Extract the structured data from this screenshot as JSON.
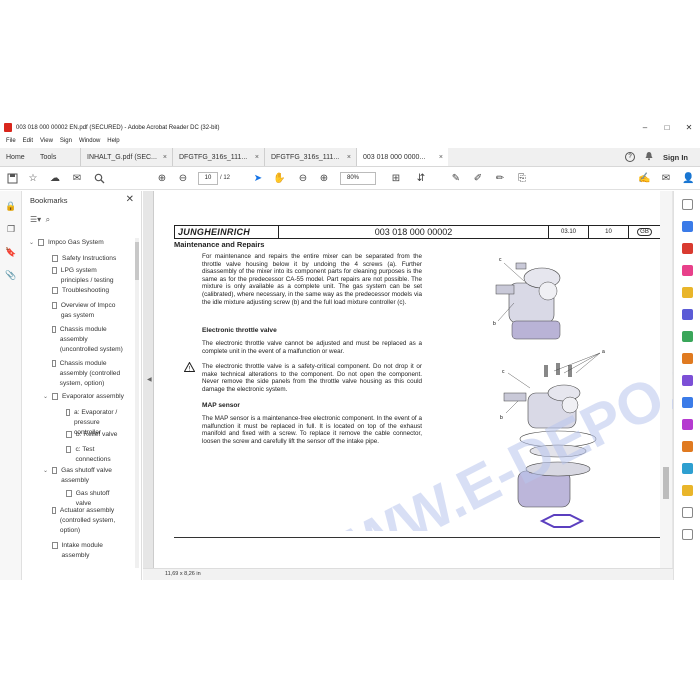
{
  "window": {
    "title": "003 018 000 00002 EN.pdf (SECURED) - Adobe Acrobat Reader DC (32-bit)",
    "minimize": "–",
    "maximize": "□",
    "close": "✕"
  },
  "menu": [
    "File",
    "Edit",
    "View",
    "Sign",
    "Window",
    "Help"
  ],
  "tabs": {
    "home": "Home",
    "tools": "Tools",
    "docs": [
      {
        "label": "INHALT_G.pdf (SEC...",
        "active": false
      },
      {
        "label": "DFGTFG_316s_111...",
        "active": false
      },
      {
        "label": "DFGTFG_316s_111...",
        "active": false
      },
      {
        "label": "003 018 000 0000...",
        "active": true
      }
    ],
    "close_glyph": "×",
    "help_glyph": "?",
    "sign_in": "Sign In"
  },
  "toolbar": {
    "page_current": "10",
    "page_total": "/ 12",
    "zoom": "80%"
  },
  "bookmarks": {
    "title": "Bookmarks",
    "close": "✕",
    "items": [
      {
        "label": "Impco Gas System",
        "level": 0,
        "twisty": "⌄"
      },
      {
        "label": "Safety Instructions",
        "level": 1
      },
      {
        "label": "LPG system principles / testing",
        "level": 1
      },
      {
        "label": "Troubleshooting",
        "level": 1
      },
      {
        "label": "Overview of Impco gas system",
        "level": 1
      },
      {
        "label": "Chassis module assembly (uncontrolled system)",
        "level": 1
      },
      {
        "label": "Chassis module assembly (controlled system, option)",
        "level": 1
      },
      {
        "label": "Evaporator assembly",
        "level": 1,
        "twisty": "⌄"
      },
      {
        "label": "a: Evaporator / pressure controller",
        "level": 2
      },
      {
        "label": "b: Relief valve",
        "level": 2
      },
      {
        "label": "c: Test connections",
        "level": 2
      },
      {
        "label": "Gas shutoff valve assembly",
        "level": 1,
        "twisty": "⌄"
      },
      {
        "label": "Gas shutoff valve",
        "level": 2
      },
      {
        "label": "Actuator assembly (controlled system, option)",
        "level": 1
      },
      {
        "label": "Intake module assembly",
        "level": 1
      }
    ]
  },
  "document": {
    "brand": "JUNGHEINRICH",
    "doc_number": "003 018 000 00002",
    "version": "03.10",
    "page": "10",
    "lang": "GB",
    "section_title": "Maintenance and Repairs",
    "para1": "For maintenance and repairs the entire mixer can be separated from the throttle valve housing below it by undoing the 4 screws (a). Further disassembly of the mixer into its component parts for cleaning purposes is the same as for the predecessor CA-55 model. Part repairs are not possible. The mixture is only available as a complete unit. The gas system can be set (calibrated), where necessary, in the same way as the predecessor models via the idle mixture adjusting screw (b) and the full load mixture controller (c).",
    "sub1": "Electronic throttle valve",
    "para2": "The electronic throttle valve cannot be adjusted and must be replaced as a complete unit in the event of a malfunction or wear.",
    "para3": "The electronic throttle valve is a safety-critical component. Do not drop it or make technical alterations to the component. Do not open the component. Never remove the side panels from the throttle valve housing as this could damage the electronic system.",
    "sub2": "MAP sensor",
    "para4": "The MAP sensor is a maintenance-free electronic component. In the event of a malfunction it must be replaced in full. It is located on top of the exhaust manifold and fixed with a screw. To replace it remove the cable connector, loosen the screw and carefully lift the sensor off the intake pipe.",
    "fig_labels": [
      "c",
      "b",
      "a",
      "c",
      "b"
    ]
  },
  "status": {
    "page_size": "11,69 x 8,26 in"
  },
  "watermark": "WWW.E-DEPO.COM",
  "colors": {
    "accent": "#1473e6",
    "watermark": "#b8c4ec"
  }
}
